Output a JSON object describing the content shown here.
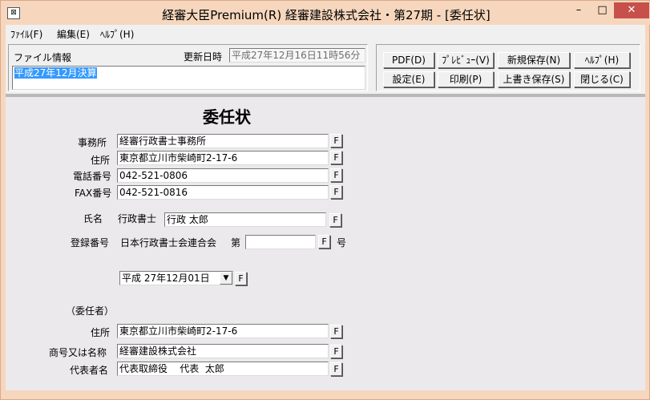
{
  "window": {
    "title": "経審大臣Premium(R)  経審建設株式会社・第27期 - [委任状]",
    "app_icon": "app-icon",
    "controls": {
      "minimize": "–",
      "maximize": "□",
      "close": "✕"
    }
  },
  "menu": [
    {
      "label": "ﾌｧｲﾙ(F)"
    },
    {
      "label": "編集(E)"
    },
    {
      "label": "ﾍﾙﾌﾟ(H)"
    }
  ],
  "file_info": {
    "label": "ファイル情報",
    "updated_label": "更新日時",
    "updated_value": "平成27年12月16日11時56分",
    "name_value": "平成27年12月決算"
  },
  "toolbar": {
    "pdf": "PDF(D)",
    "preview": "ﾌﾟﾚﾋﾞｭｰ(V)",
    "save_new": "新規保存(N)",
    "help": "ﾍﾙﾌﾟ(H)",
    "settings": "設定(E)",
    "print": "印刷(P)",
    "overwrite": "上書き保存(S)",
    "close": "閉じる(C)"
  },
  "document": {
    "title": "委任状",
    "f_label": "F",
    "agent": {
      "office_label": "事務所",
      "office_value": "経審行政書士事務所",
      "address_label": "住所",
      "address_value": "東京都立川市柴崎町2-17-6",
      "phone_label": "電話番号",
      "phone_value": "042-521-0806",
      "fax_label": "FAX番号",
      "fax_value": "042-521-0816",
      "name_label": "氏名",
      "name_prefix": "行政書士",
      "name_value": "行政  太郎",
      "reg_label": "登録番号",
      "reg_org": "日本行政書士会連合会",
      "reg_dai": "第",
      "reg_value": "",
      "reg_go": "号"
    },
    "date": {
      "value": "平成 27年12月01日",
      "dropdown_icon": "▼"
    },
    "principal": {
      "section_label": "（委任者）",
      "address_label": "住所",
      "address_value": "東京都立川市柴崎町2-17-6",
      "company_label": "商号又は名称",
      "company_value": "経審建設株式会社",
      "rep_label": "代表者名",
      "rep_value": "代表取締役    代表  太郎"
    }
  }
}
